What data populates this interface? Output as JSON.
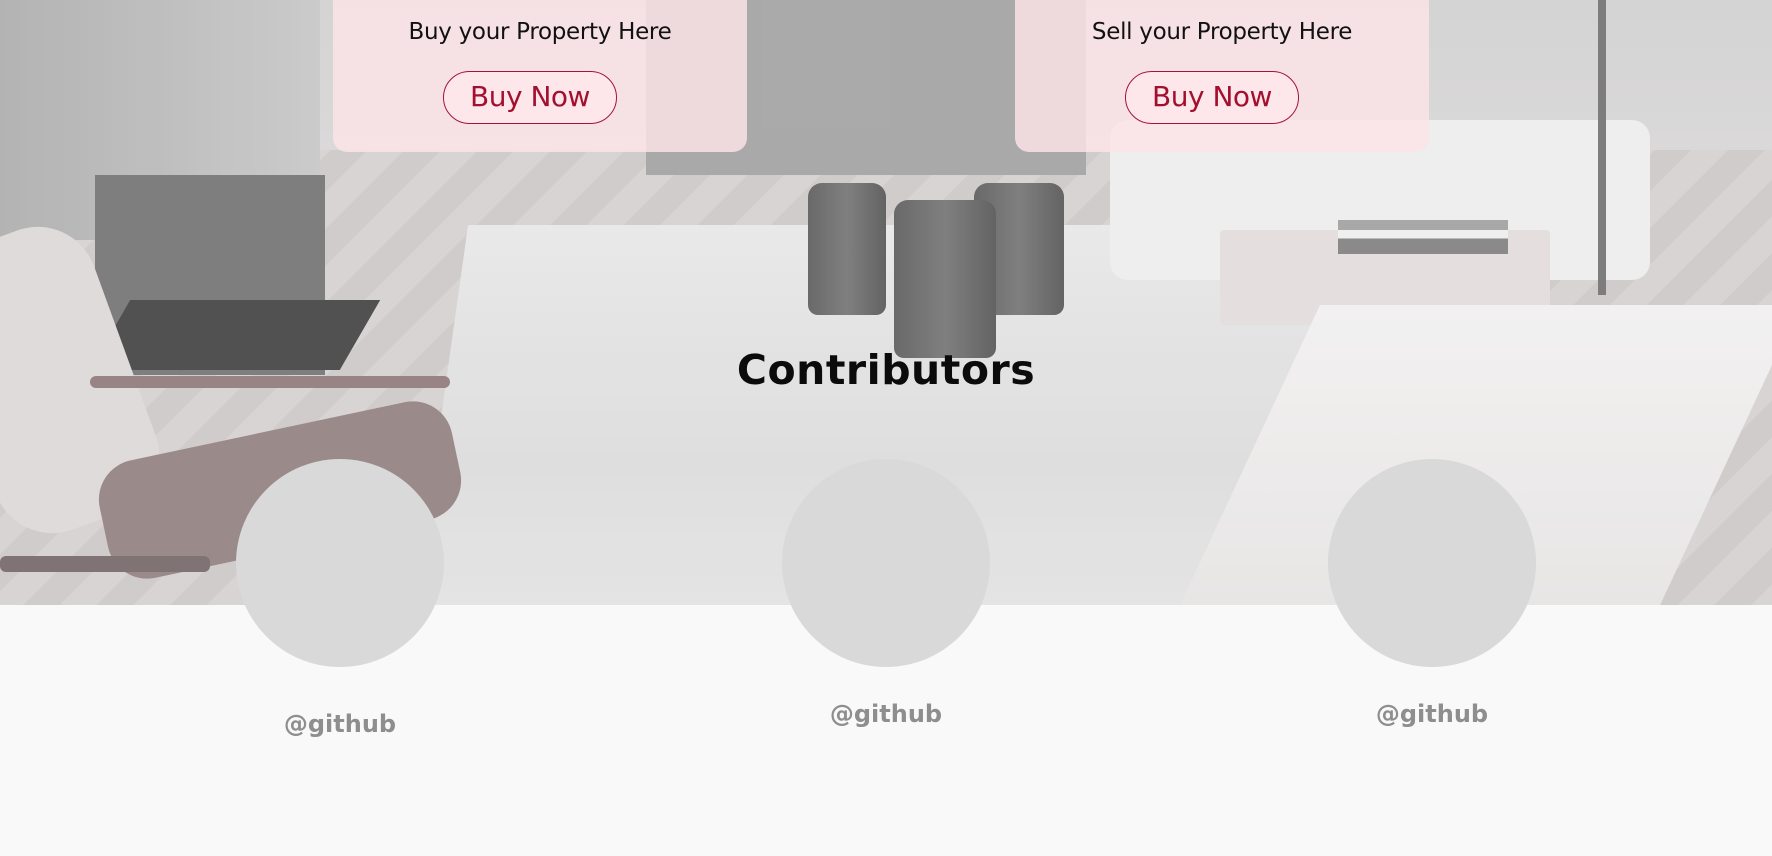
{
  "cards": {
    "buy": {
      "text": "Buy your Property Here",
      "button_label": "Buy Now"
    },
    "sell": {
      "text": "Sell your Property Here",
      "button_label": "Buy Now"
    }
  },
  "contributors": {
    "title": "Contributors",
    "people": [
      {
        "handle": "@github"
      },
      {
        "handle": "@github"
      },
      {
        "handle": "@github"
      }
    ]
  },
  "colors": {
    "card_background": "#fce4e8",
    "button_text": "#a3102f",
    "button_border": "#a51338",
    "avatar_placeholder": "#d9d9d9",
    "handle_text": "#8e8e8e",
    "page_background": "#f9f9f9"
  }
}
